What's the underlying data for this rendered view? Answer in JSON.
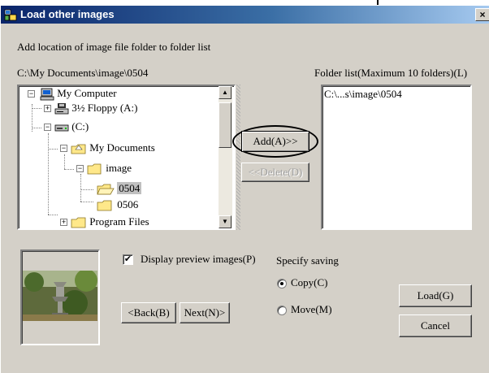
{
  "window": {
    "title": "Load other images",
    "close_glyph": "×"
  },
  "labels": {
    "instruction": "Add location of image file folder to folder list",
    "current_path": "C:\\My Documents\\image\\0504",
    "folder_list": "Folder list(Maximum 10 folders)(L)"
  },
  "tree": {
    "items": [
      {
        "label": "My Computer",
        "icon": "computer-icon"
      },
      {
        "label": "3½ Floppy (A:)",
        "icon": "floppy-drive-icon"
      },
      {
        "label": "(C:)",
        "icon": "hard-drive-icon"
      },
      {
        "label": "My Documents",
        "icon": "my-documents-icon"
      },
      {
        "label": "image",
        "icon": "folder-open-icon"
      },
      {
        "label": "0504",
        "icon": "folder-open-icon",
        "selected": true
      },
      {
        "label": "0506",
        "icon": "folder-icon"
      },
      {
        "label": "Program Files",
        "icon": "folder-icon"
      }
    ]
  },
  "folder_list": {
    "items": [
      "C:\\...s\\image\\0504"
    ]
  },
  "buttons": {
    "add": "Add(A)>>",
    "delete": "<<Delete(D)",
    "back": "<Back(B)",
    "next": "Next(N)>",
    "load": "Load(G)",
    "cancel": "Cancel"
  },
  "preview": {
    "checkbox_label": "Display preview images(P)",
    "checked": true
  },
  "saving": {
    "label": "Specify saving",
    "options": [
      {
        "label": "Copy(C)",
        "selected": true
      },
      {
        "label": "Move(M)",
        "selected": false
      }
    ]
  },
  "colors": {
    "titlebar_start": "#0a246a",
    "titlebar_end": "#a6caf0",
    "face": "#d4d0c8",
    "selection": "#c0c0c0"
  }
}
